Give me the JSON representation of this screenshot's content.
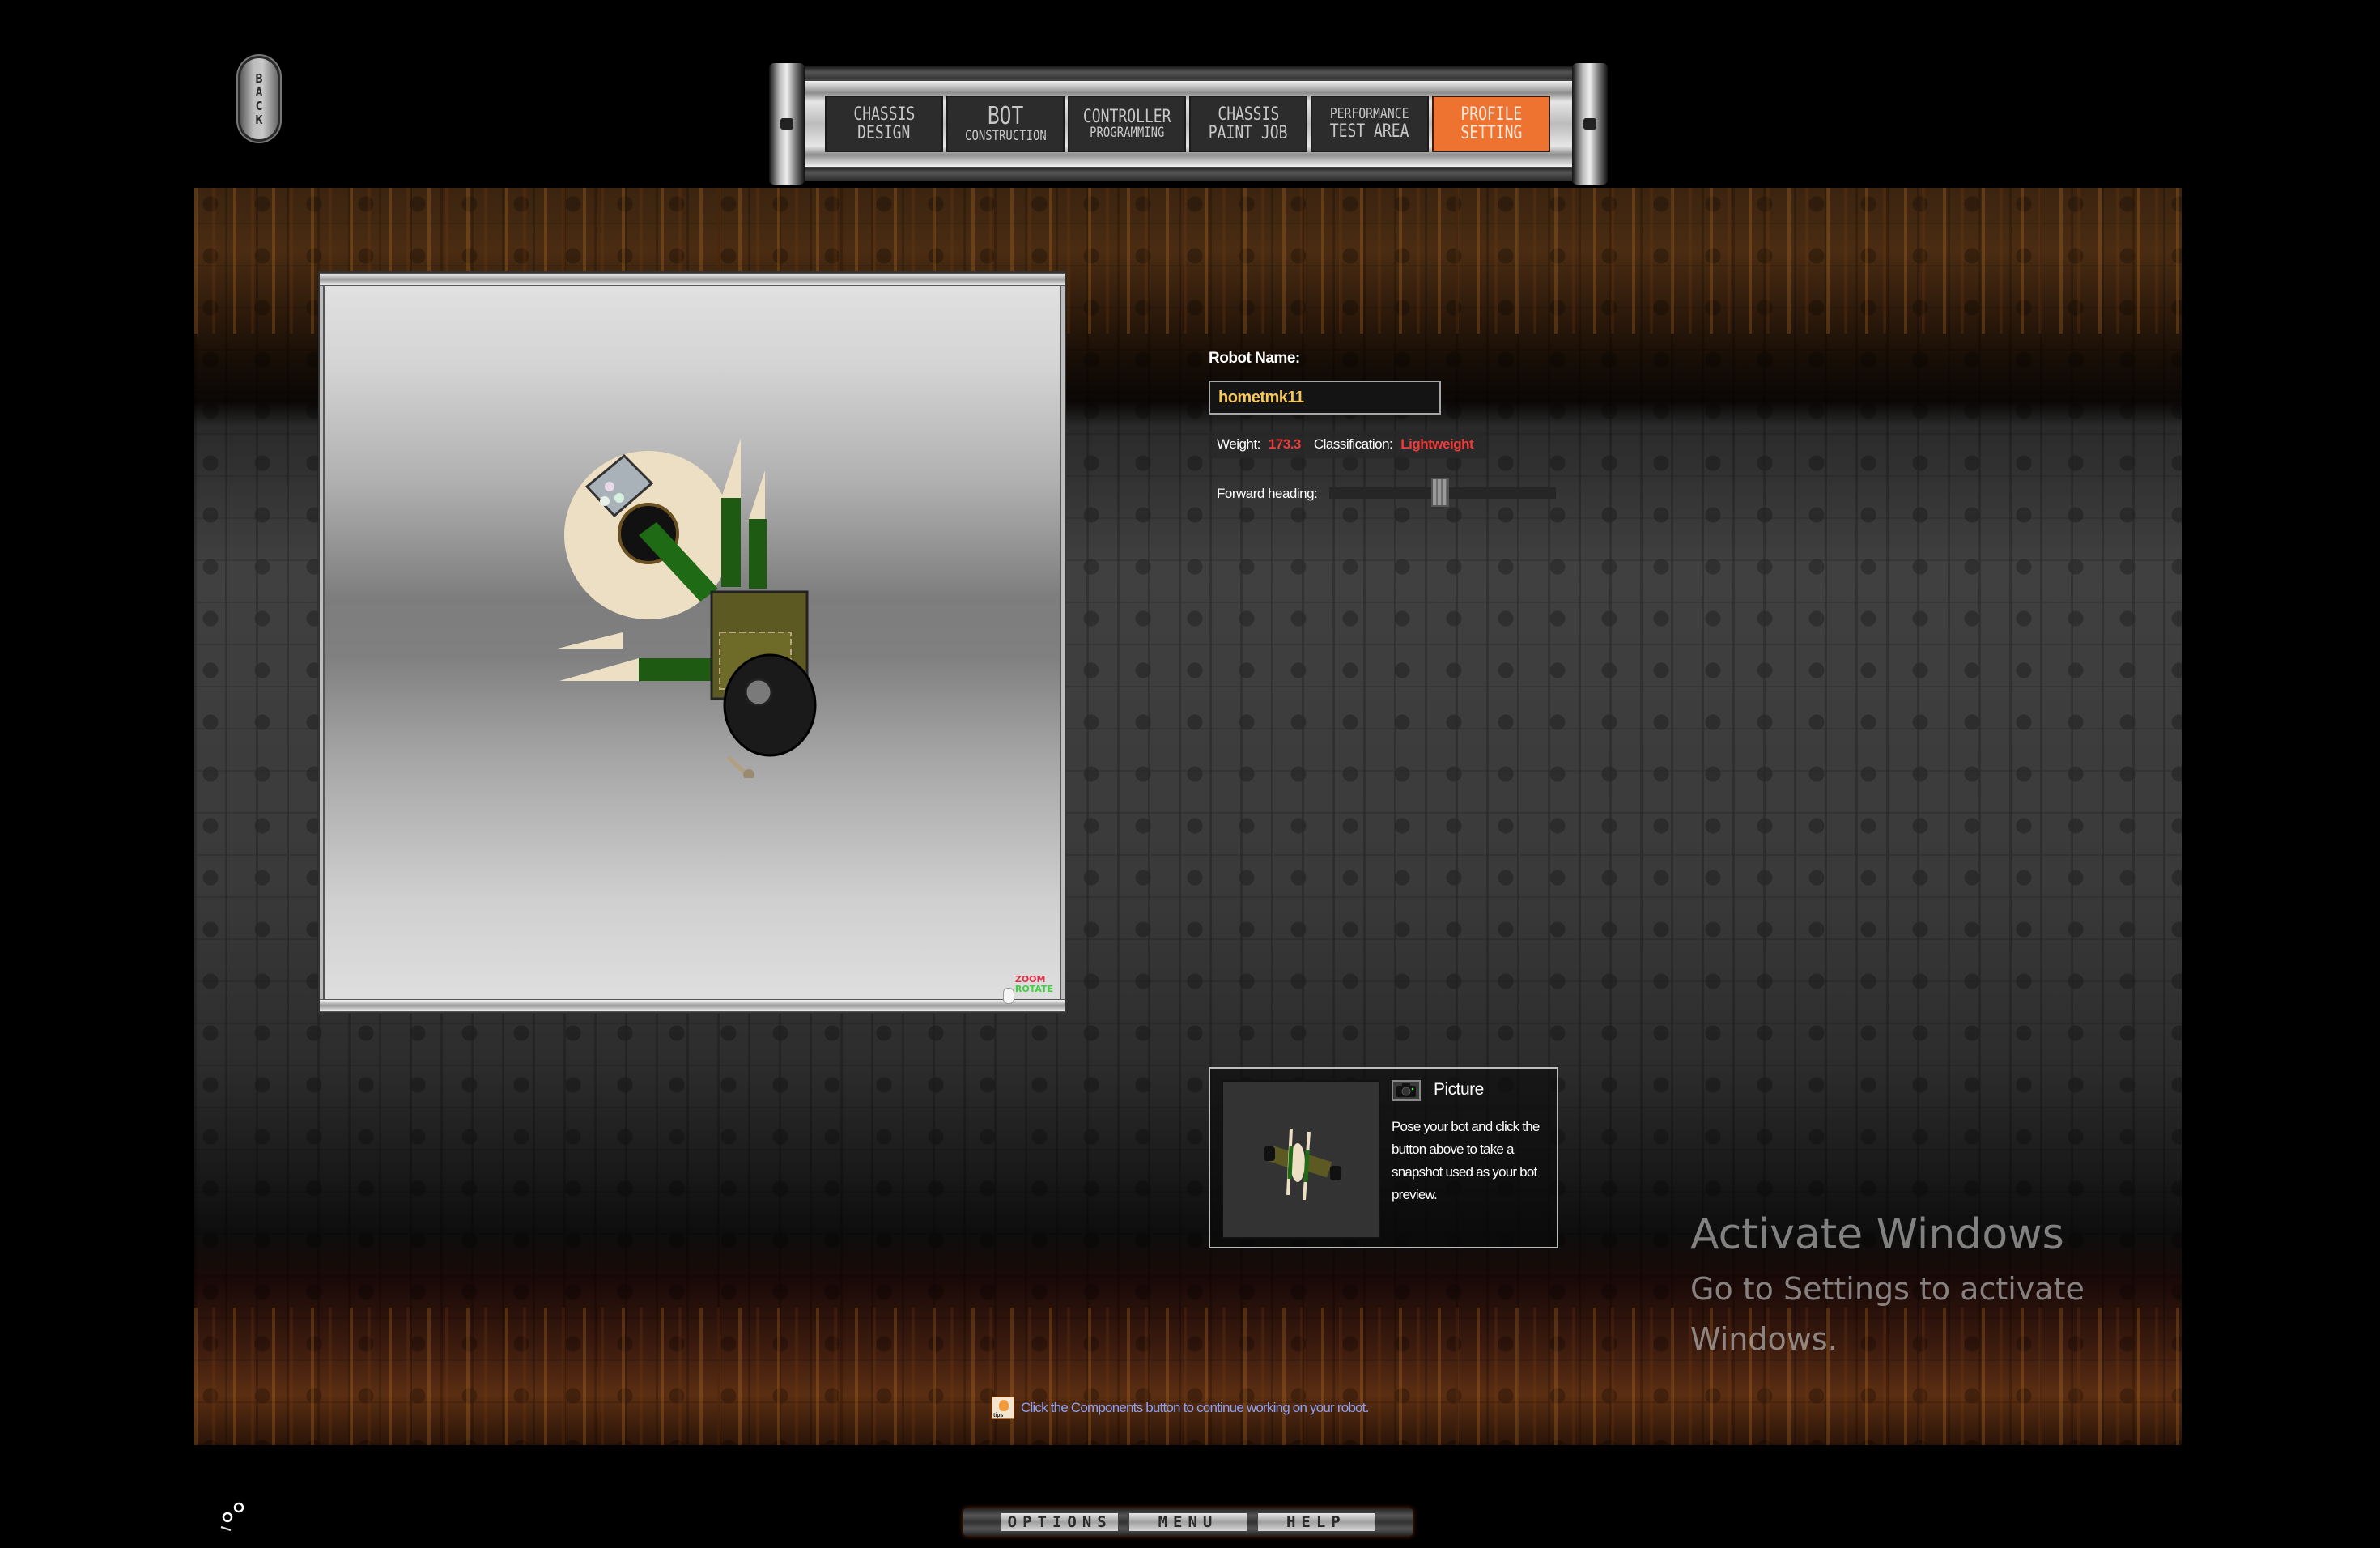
{
  "back_button": {
    "label": "BACK"
  },
  "nav": {
    "tabs": [
      {
        "line1": "CHASSIS",
        "line2": "DESIGN",
        "active": false
      },
      {
        "line1": "BOT",
        "line2": "CONSTRUCTION",
        "active": false
      },
      {
        "line1": "CONTROLLER",
        "line2": "PROGRAMMING",
        "active": false
      },
      {
        "line1": "CHASSIS",
        "line2": "PAINT JOB",
        "active": false
      },
      {
        "line1": "PERFORMANCE",
        "line2": "TEST AREA",
        "active": false
      },
      {
        "line1": "PROFILE",
        "line2": "SETTING",
        "active": true
      }
    ],
    "active_color": "#ee7330"
  },
  "viewport": {
    "hint_zoom": "ZOOM",
    "hint_rotate": "ROTATE"
  },
  "profile": {
    "robot_name_label": "Robot Name:",
    "robot_name_value": "hometmk11",
    "weight_label": "Weight:",
    "weight_value": "173.3",
    "classification_label": "Classification:",
    "classification_value": "Lightweight",
    "forward_heading_label": "Forward heading:",
    "forward_heading_fraction": 0.49,
    "name_color": "#f4c85a",
    "value_color": "#ee3b3b"
  },
  "picture": {
    "title": "Picture",
    "description": "Pose your bot and click the button above to take a snapshot used as your bot preview."
  },
  "tip": {
    "icon": "tips-lightbulb-icon",
    "text": "Click the Components button to continue working on your robot."
  },
  "watermark": {
    "heading": "Activate Windows",
    "subtext": "Go to Settings to activate Windows."
  },
  "bottom_bar": {
    "options_label": "OPTIONS",
    "menu_label": "MENU",
    "help_label": "HELP"
  }
}
